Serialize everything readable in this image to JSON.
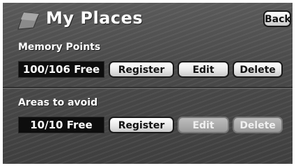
{
  "header": {
    "title": "My Places",
    "back_label": "Back",
    "icon": "flag-icon"
  },
  "memory_points": {
    "label": "Memory Points",
    "count": "100/106  Free",
    "register_label": "Register",
    "edit_label": "Edit",
    "delete_label": "Delete"
  },
  "areas_to_avoid": {
    "label": "Areas to avoid",
    "count": "10/10  Free",
    "register_label": "Register",
    "edit_label": "Edit",
    "delete_label": "Delete",
    "edit_enabled": false,
    "delete_enabled": false
  }
}
